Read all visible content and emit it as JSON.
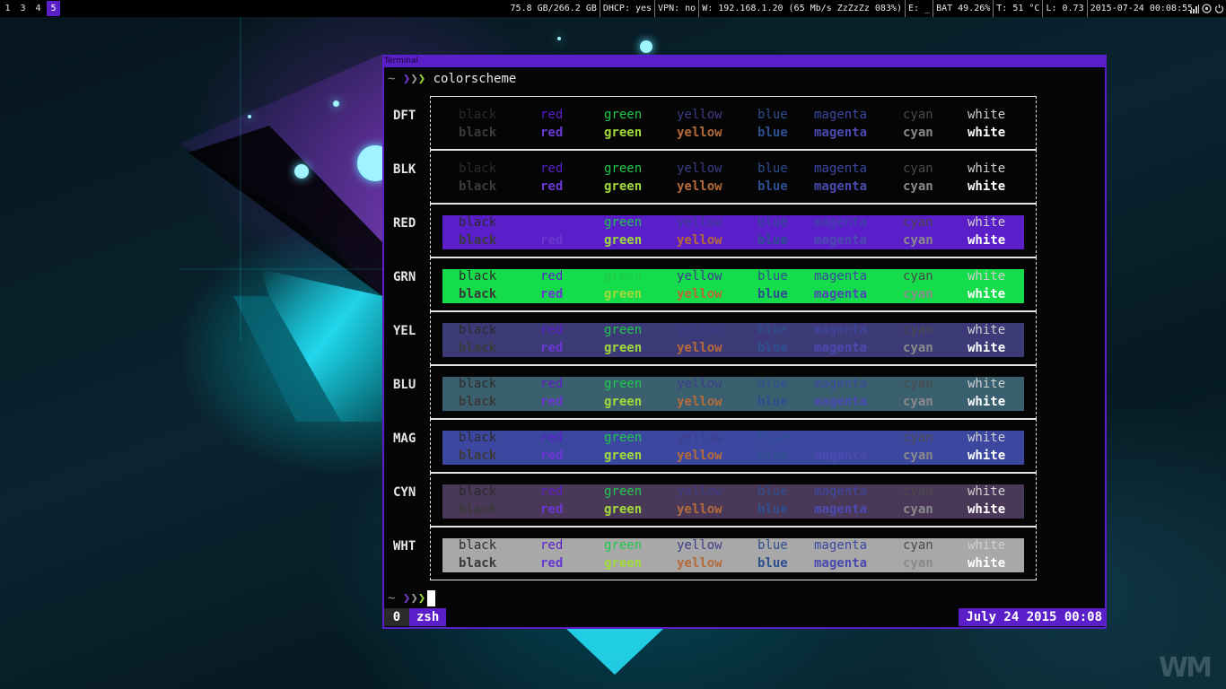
{
  "workspaces": [
    {
      "label": "1",
      "active": false
    },
    {
      "label": "3",
      "active": false
    },
    {
      "label": "4",
      "active": false
    },
    {
      "label": "5",
      "active": true
    }
  ],
  "status": {
    "disk": "75.8 GB/266.2 GB",
    "dhcp": "DHCP: yes",
    "vpn": "VPN: no",
    "wifi": "W: 192.168.1.20 (65 Mb/s ZzZzZz 083%)",
    "ethernet": "E: _",
    "battery": "BAT 49.26%",
    "temperature": "T: 51 °C",
    "load": "L: 0.73",
    "datetime": "2015-07-24 00:08:55",
    "icons": [
      "signal-bars-icon",
      "wifi-circle-icon",
      "power-icon"
    ]
  },
  "terminal": {
    "title": "Terminal",
    "prompt": {
      "tilde": "~",
      "arrows": [
        "❯",
        "❯",
        "❯"
      ],
      "command": "colorscheme"
    },
    "rows": [
      {
        "label": "DFT"
      },
      {
        "label": "BLK"
      },
      {
        "label": "RED"
      },
      {
        "label": "GRN"
      },
      {
        "label": "YEL"
      },
      {
        "label": "BLU"
      },
      {
        "label": "MAG"
      },
      {
        "label": "CYN"
      },
      {
        "label": "WHT"
      }
    ],
    "color_names": [
      "black",
      "red",
      "green",
      "yellow",
      "blue",
      "magenta",
      "cyan",
      "white"
    ],
    "tmux": {
      "window_index": "0",
      "window_name": "zsh",
      "clock": "July 24 2015 00:08"
    }
  },
  "palette": {
    "accent": "#5a1fc8",
    "normal": [
      "#2b2b2b",
      "#5a1fc8",
      "#20c84a",
      "#3d3d8a",
      "#2e4f8f",
      "#3c48a0",
      "#4a4a4a",
      "#d0d0d0"
    ],
    "bright": [
      "#3a3a3a",
      "#6a38d0",
      "#9fd93a",
      "#b56a3a",
      "#2e4f8f",
      "#4a4ab0",
      "#8a8a8a",
      "#ffffff"
    ],
    "backgrounds": [
      null,
      null,
      "#5a1fc8",
      "#14dc4a",
      "#3d3a78",
      "#3a6070",
      "#3c48a0",
      "#4a3858",
      "#a8a8a8"
    ]
  },
  "watermark": "WM"
}
